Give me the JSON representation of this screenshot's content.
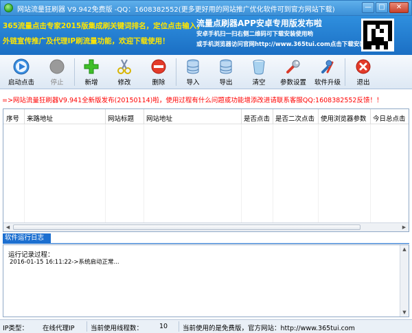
{
  "window": {
    "title": "网站流量狂刷器  V9.942免费版  -QQ：1608382552(更多更好用的网站推广优化软件可到官方网站下载)",
    "minimize": "—",
    "maximize": "□",
    "close": "✕"
  },
  "banner": {
    "left_line1": "365流量点击专家2015版集成刷关键词排名，定位点击输入，",
    "left_line2": "外链宣传推广及代理IP刷流量功能，欢迎下载使用！",
    "right_title": "流量点刷器APP安卓专用版发布啦",
    "right_line1": "安卓手机扫一扫右侧二维码可下载安装使用哟",
    "right_line2": "或手机浏览器访问官网http://www.365tui.com点击下载安装"
  },
  "toolbar": {
    "start": "启动点击",
    "stop": "停止",
    "add": "新增",
    "edit": "修改",
    "delete": "删除",
    "import": "导入",
    "export": "导出",
    "clear": "清空",
    "settings": "参数设置",
    "upgrade": "软件升级",
    "exit": "退出"
  },
  "marquee": {
    "text": "=>网站流量狂刷器V9.941全新版发布(20150114)啦，使用过程有什么问题或功能增添改进请联系客服QQ:1608382552反馈！！"
  },
  "table": {
    "columns": [
      "序号",
      "来路地址",
      "网站标题",
      "网站地址",
      "是否点击",
      "是否二次点击",
      "使用浏览器参数",
      "今日总点击"
    ],
    "rows": []
  },
  "log": {
    "tab": "软件运行日志",
    "title": "运行记录过程：",
    "lines": [
      "2016-01-15 16:11:22->系统启动正常..."
    ]
  },
  "status": {
    "ip_label": "IP类型：",
    "ip_value": "在线代理IP",
    "threads_label": "当前使用线程数：",
    "threads_value": "10",
    "version_text": "当前使用的是免费版，官方网站：http://www.365tui.com"
  },
  "colors": {
    "titlebar": "#3b8fd6",
    "banner": "#1b6fc4",
    "banner_left_text": "#ffe600",
    "marquee_text": "#ff0000",
    "log_tab": "#1c6fd0"
  }
}
